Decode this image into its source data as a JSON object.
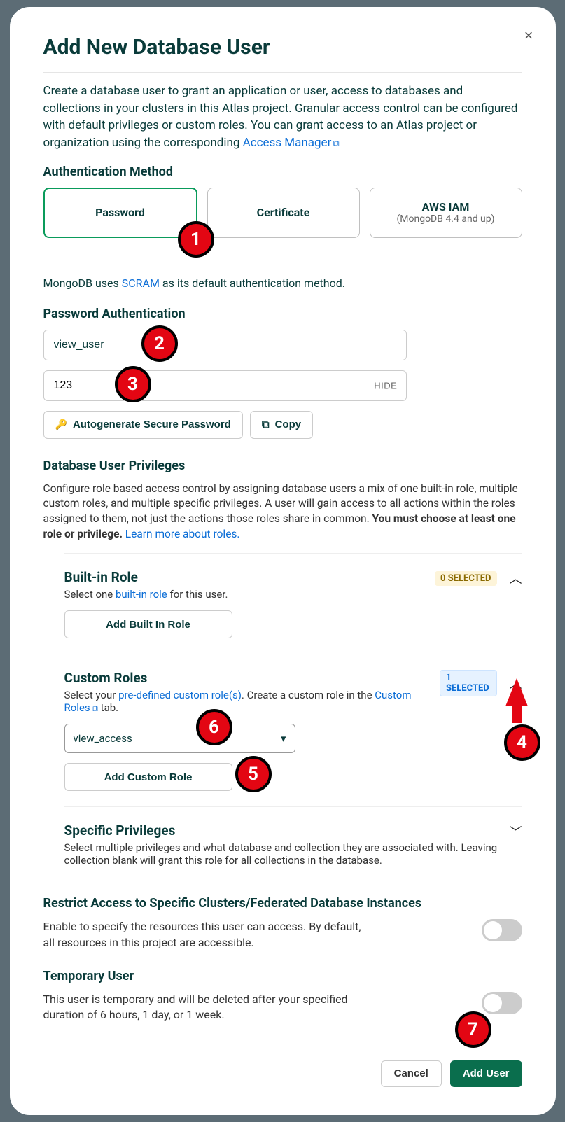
{
  "modal": {
    "title": "Add New Database User",
    "close_label": "×",
    "intro_text_1": "Create a database user to grant an application or user, access to databases and collections in your clusters in this Atlas project. Granular access control can be configured with default privileges or custom roles. You can grant access to an Atlas project or organization using the corresponding ",
    "intro_link": "Access Manager"
  },
  "auth": {
    "heading": "Authentication Method",
    "options": {
      "password": "Password",
      "certificate": "Certificate",
      "aws": "AWS IAM",
      "aws_sub": "(MongoDB 4.4 and up)"
    }
  },
  "scram": {
    "prefix": "MongoDB uses ",
    "link": "SCRAM",
    "suffix": " as its default authentication method."
  },
  "pwd_auth": {
    "heading": "Password Authentication",
    "username_value": "view_user",
    "password_value": "123",
    "hide_label": "HIDE",
    "autogen_label": "Autogenerate Secure Password",
    "copy_label": "Copy"
  },
  "privileges": {
    "heading": "Database User Privileges",
    "desc_1": "Configure role based access control by assigning database users a mix of one built-in role, multiple custom roles, and multiple specific privileges. A user will gain access to all actions within the roles assigned to them, not just the actions those roles share in common. ",
    "desc_bold": "You must choose at least one role or privilege.",
    "learn_link": " Learn more about roles.",
    "builtin": {
      "title": "Built-in Role",
      "sub_prefix": "Select one ",
      "sub_link": "built-in role",
      "sub_suffix": " for this user.",
      "badge": "0 SELECTED",
      "add_btn": "Add Built In Role"
    },
    "custom": {
      "title": "Custom Roles",
      "sub_prefix": "Select your ",
      "sub_link": "pre-defined custom role(s)",
      "sub_mid": ". Create a custom role in the ",
      "sub_link2": "Custom Roles",
      "sub_suffix": " tab.",
      "badge": "1 SELECTED",
      "select_value": "view_access",
      "add_btn": "Add Custom Role"
    },
    "specific": {
      "title": "Specific Privileges",
      "sub": "Select multiple privileges and what database and collection they are associated with. Leaving collection blank will grant this role for all collections in the database."
    }
  },
  "restrict": {
    "heading": "Restrict Access to Specific Clusters/Federated Database Instances",
    "desc": "Enable to specify the resources this user can access. By default, all resources in this project are accessible."
  },
  "temp": {
    "heading": "Temporary User",
    "desc": "This user is temporary and will be deleted after your specified duration of 6 hours, 1 day, or 1 week."
  },
  "footer": {
    "cancel": "Cancel",
    "add": "Add User"
  },
  "annotations": {
    "1": "1",
    "2": "2",
    "3": "3",
    "4": "4",
    "5": "5",
    "6": "6",
    "7": "7"
  }
}
